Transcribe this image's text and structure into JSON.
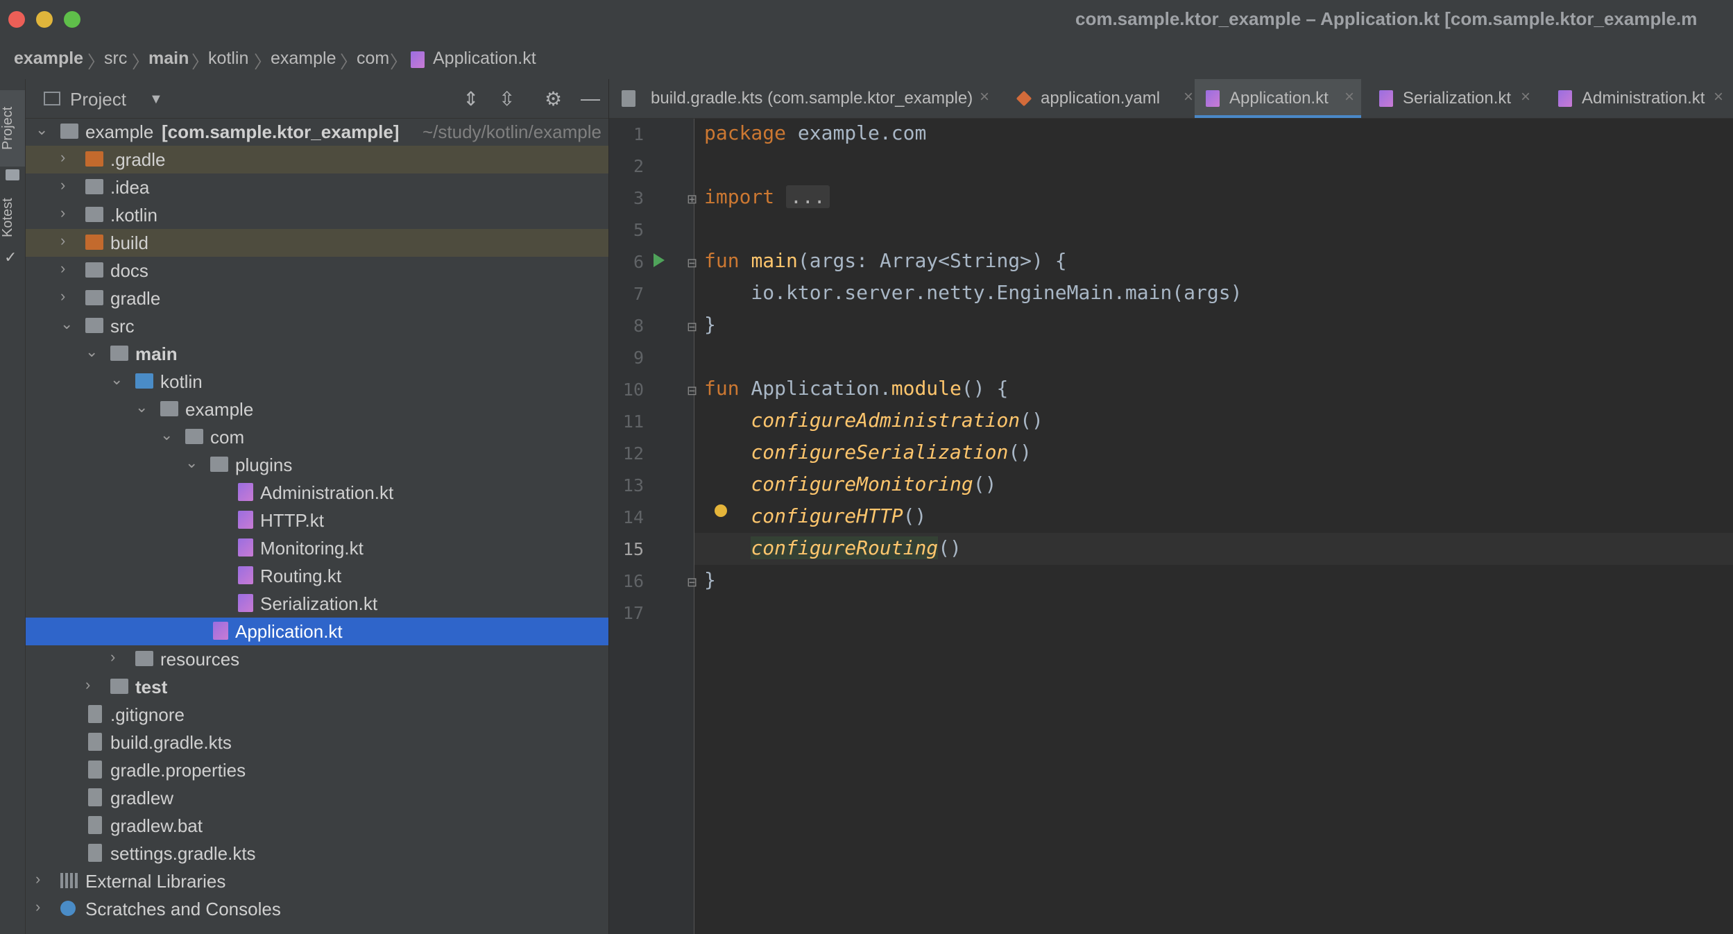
{
  "window": {
    "title": "com.sample.ktor_example – Application.kt [com.sample.ktor_example.m"
  },
  "breadcrumb": [
    "example",
    "src",
    "main",
    "kotlin",
    "example",
    "com",
    "Application.kt"
  ],
  "stripe": {
    "project_tab": "Project",
    "kotest_tab": "Kotest"
  },
  "panel": {
    "title": "Project"
  },
  "tree": [
    {
      "label": "example",
      "extra": "[com.sample.ktor_example]",
      "path": "~/study/kotlin/example"
    },
    {
      "label": ".gradle"
    },
    {
      "label": ".idea"
    },
    {
      "label": ".kotlin"
    },
    {
      "label": "build"
    },
    {
      "label": "docs"
    },
    {
      "label": "gradle"
    },
    {
      "label": "src"
    },
    {
      "label": "main"
    },
    {
      "label": "kotlin"
    },
    {
      "label": "example"
    },
    {
      "label": "com"
    },
    {
      "label": "plugins"
    },
    {
      "label": "Administration.kt"
    },
    {
      "label": "HTTP.kt"
    },
    {
      "label": "Monitoring.kt"
    },
    {
      "label": "Routing.kt"
    },
    {
      "label": "Serialization.kt"
    },
    {
      "label": "Application.kt"
    },
    {
      "label": "resources"
    },
    {
      "label": "test"
    },
    {
      "label": ".gitignore"
    },
    {
      "label": "build.gradle.kts"
    },
    {
      "label": "gradle.properties"
    },
    {
      "label": "gradlew"
    },
    {
      "label": "gradlew.bat"
    },
    {
      "label": "settings.gradle.kts"
    },
    {
      "label": "External Libraries"
    },
    {
      "label": "Scratches and Consoles"
    }
  ],
  "tabs": [
    {
      "label": "build.gradle.kts (com.sample.ktor_example)"
    },
    {
      "label": "application.yaml"
    },
    {
      "label": "Application.kt"
    },
    {
      "label": "Serialization.kt"
    },
    {
      "label": "Administration.kt"
    }
  ],
  "editor": {
    "line_numbers": [
      "1",
      "2",
      "3",
      "5",
      "6",
      "7",
      "8",
      "9",
      "10",
      "11",
      "12",
      "13",
      "14",
      "15",
      "16",
      "17"
    ],
    "code": {
      "l1_kw": "package",
      "l1_rest": " example.com",
      "l3_kw": "import",
      "l3_dots": "...",
      "l6_kw": "fun",
      "l6_fn": "main",
      "l6_rest": "(args: Array<String>) {",
      "l7": "    io.ktor.server.netty.EngineMain.main(args)",
      "l8": "}",
      "l10_kw": "fun",
      "l10_recv": " Application.",
      "l10_fn": "module",
      "l10_rest": "() {",
      "l11_fn": "configureAdministration",
      "l12_fn": "configureSerialization",
      "l13_fn": "configureMonitoring",
      "l14_fn": "configureHTTP",
      "l15_fn": "configureRouting",
      "parens": "()",
      "l16": "}"
    }
  }
}
